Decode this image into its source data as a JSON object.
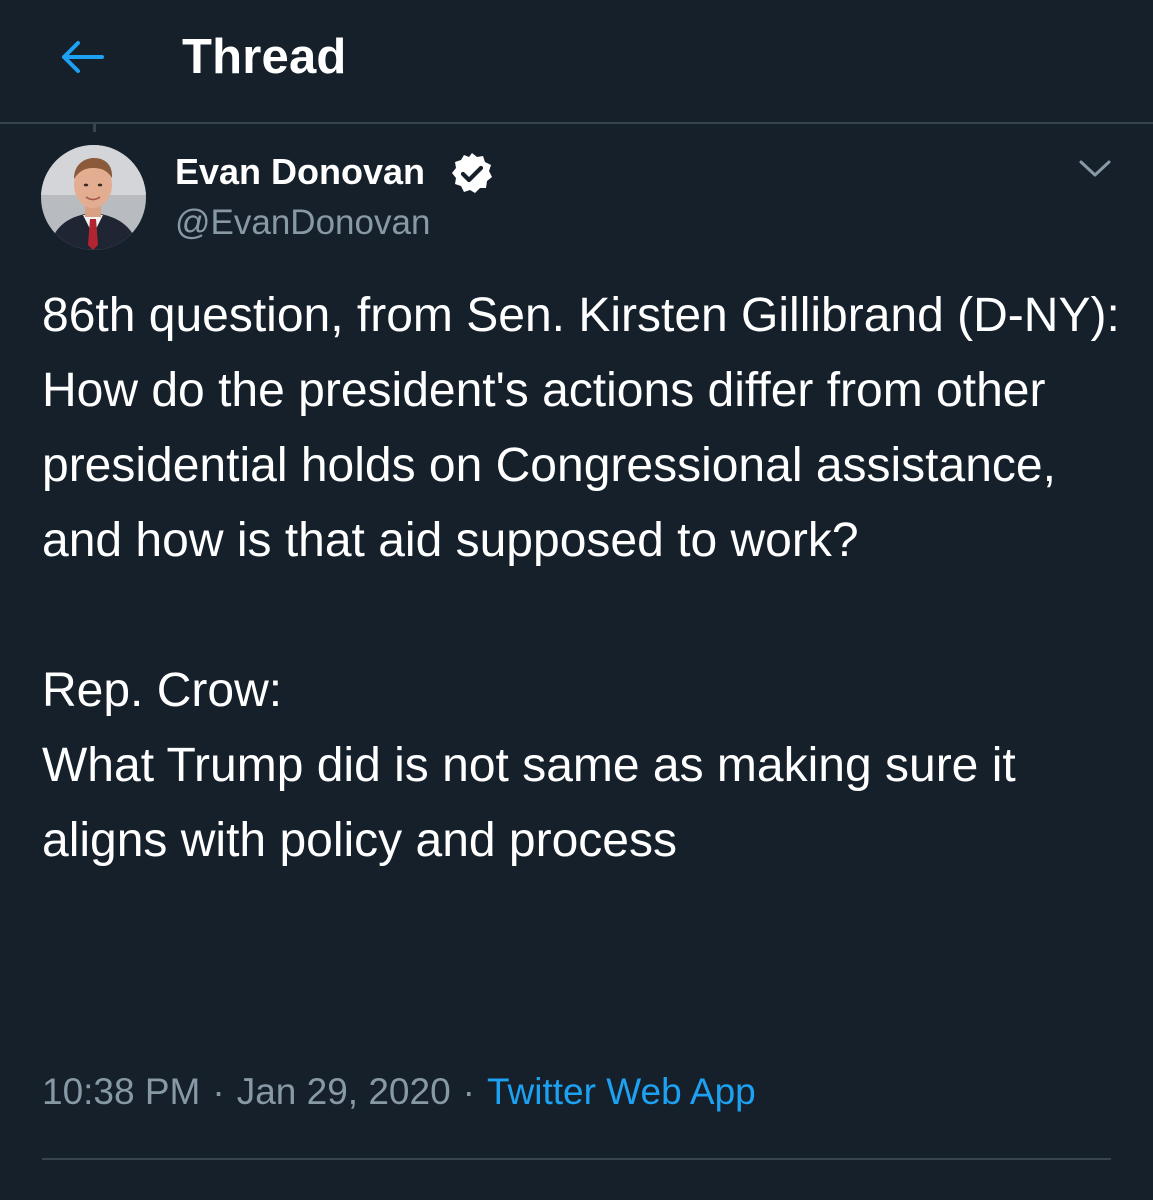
{
  "header": {
    "title": "Thread",
    "back_icon": "arrow-left-icon",
    "accent_color": "#1da1f2"
  },
  "tweet": {
    "author": {
      "name": "Evan Donovan",
      "handle": "@EvanDonovan",
      "verified": true,
      "verified_icon": "verified-badge-icon"
    },
    "lines": [
      "86th question, from Sen. Kirsten Gillibrand (D-NY):",
      "How do the president's actions differ from other presidential holds on Congressional assistance, and how is that aid supposed to work?",
      "",
      "Rep. Crow:",
      "What Trump did is not same as making sure it aligns with policy and process"
    ],
    "time": "10:38 PM",
    "date": "Jan 29, 2020",
    "separator": "·",
    "source": "Twitter Web App",
    "menu_icon": "chevron-down-icon"
  },
  "colors": {
    "background": "#15202b",
    "text_primary": "#ffffff",
    "text_secondary": "#8899a6",
    "link": "#1da1f2",
    "divider": "#38444d"
  }
}
